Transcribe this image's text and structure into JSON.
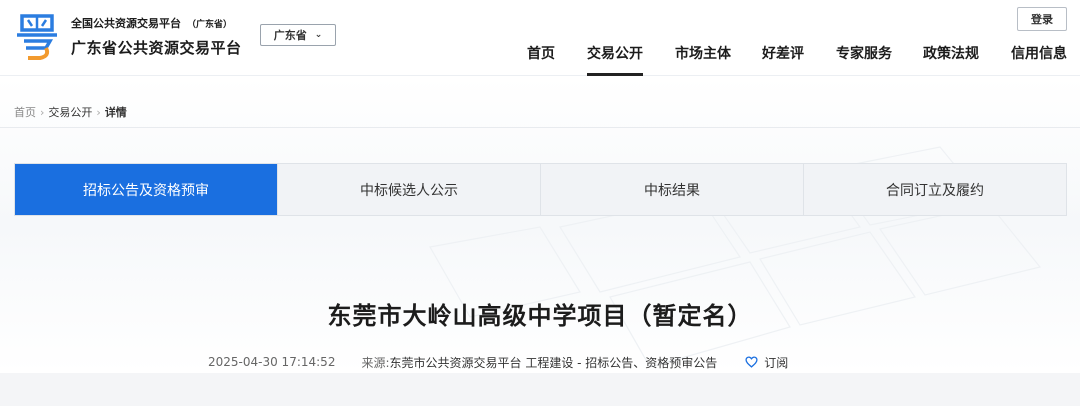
{
  "header": {
    "platform_national": "全国公共资源交易平台",
    "platform_national_sub": "（广东省）",
    "platform_name": "广东省公共资源交易平台",
    "region_select": "广东省",
    "login_label": "登录",
    "logo_icon": "yue-logo-icon"
  },
  "nav": {
    "items": [
      {
        "label": "首页"
      },
      {
        "label": "交易公开"
      },
      {
        "label": "市场主体"
      },
      {
        "label": "好差评"
      },
      {
        "label": "专家服务"
      },
      {
        "label": "政策法规"
      },
      {
        "label": "信用信息"
      }
    ],
    "active_index": 1
  },
  "breadcrumb": {
    "home": "首页",
    "section": "交易公开",
    "current": "详情",
    "separator": "›"
  },
  "tabs": {
    "items": [
      {
        "label": "招标公告及资格预审"
      },
      {
        "label": "中标候选人公示"
      },
      {
        "label": "中标结果"
      },
      {
        "label": "合同订立及履约"
      }
    ],
    "active_index": 0
  },
  "article": {
    "title": "东莞市大岭山高级中学项目（暂定名）",
    "time": "2025-04-30 17:14:52",
    "source_label": "来源: ",
    "source": "东莞市公共资源交易平台 工程建设 - 招标公告、资格预审公告",
    "subscribe_label": "订阅",
    "subscribe_icon": "heart-icon"
  },
  "colors": {
    "accent": "#1a6fe0",
    "logo_blue": "#2b7de0",
    "logo_orange": "#f29a2e"
  }
}
